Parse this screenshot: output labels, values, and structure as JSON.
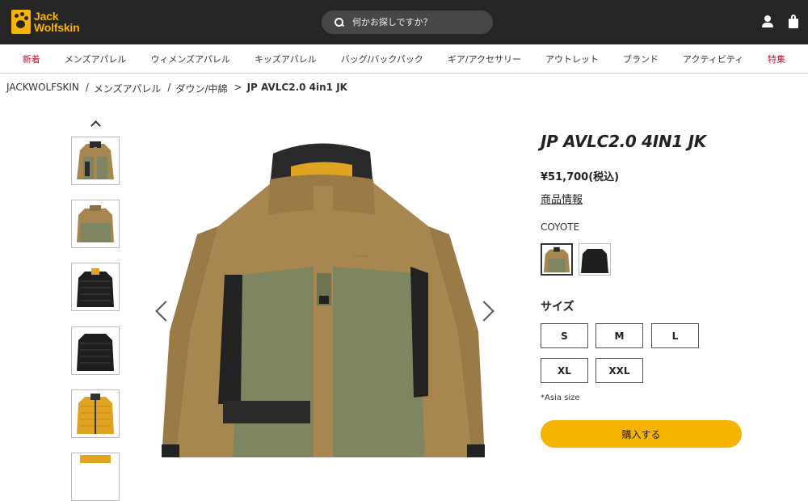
{
  "header": {
    "logo_line1": "Jack",
    "logo_line2": "Wolfskin",
    "search_placeholder": "何かお探しですか？"
  },
  "nav": [
    {
      "label": "新着",
      "highlight": true
    },
    {
      "label": "メンズアパレル",
      "highlight": false
    },
    {
      "label": "ウィメンズアパレル",
      "highlight": false
    },
    {
      "label": "キッズアパレル",
      "highlight": false
    },
    {
      "label": "バッグ/バックパック",
      "highlight": false
    },
    {
      "label": "ギア/アクセサリー",
      "highlight": false
    },
    {
      "label": "アウトレット",
      "highlight": false
    },
    {
      "label": "ブランド",
      "highlight": false
    },
    {
      "label": "アクティビティ",
      "highlight": false
    },
    {
      "label": "特集",
      "highlight": true
    }
  ],
  "breadcrumb": [
    {
      "label": "JACKWOLFSKIN"
    },
    {
      "sep": "/",
      "label": "メンズアパレル"
    },
    {
      "sep": "/",
      "label": "ダウン/中綿"
    },
    {
      "sep": ">",
      "label": "JP AVLC2.0 4in1 JK"
    }
  ],
  "product": {
    "title": "JP AVLC2.0 4IN1 JK",
    "price": "¥51,700(税込)",
    "info_link": "商品情報",
    "color_name": "COYOTE",
    "size_label": "サイズ",
    "sizes": [
      "S",
      "M",
      "L",
      "XL",
      "XXL"
    ],
    "size_note": "*Asia size",
    "buy_label": "購入する"
  },
  "colors": {
    "accent": "#f6b400",
    "header_bg": "#262626",
    "nav_highlight": "#c8102e",
    "coyote": "#a8864f",
    "olive": "#7d8660",
    "black": "#1e1e1e"
  }
}
